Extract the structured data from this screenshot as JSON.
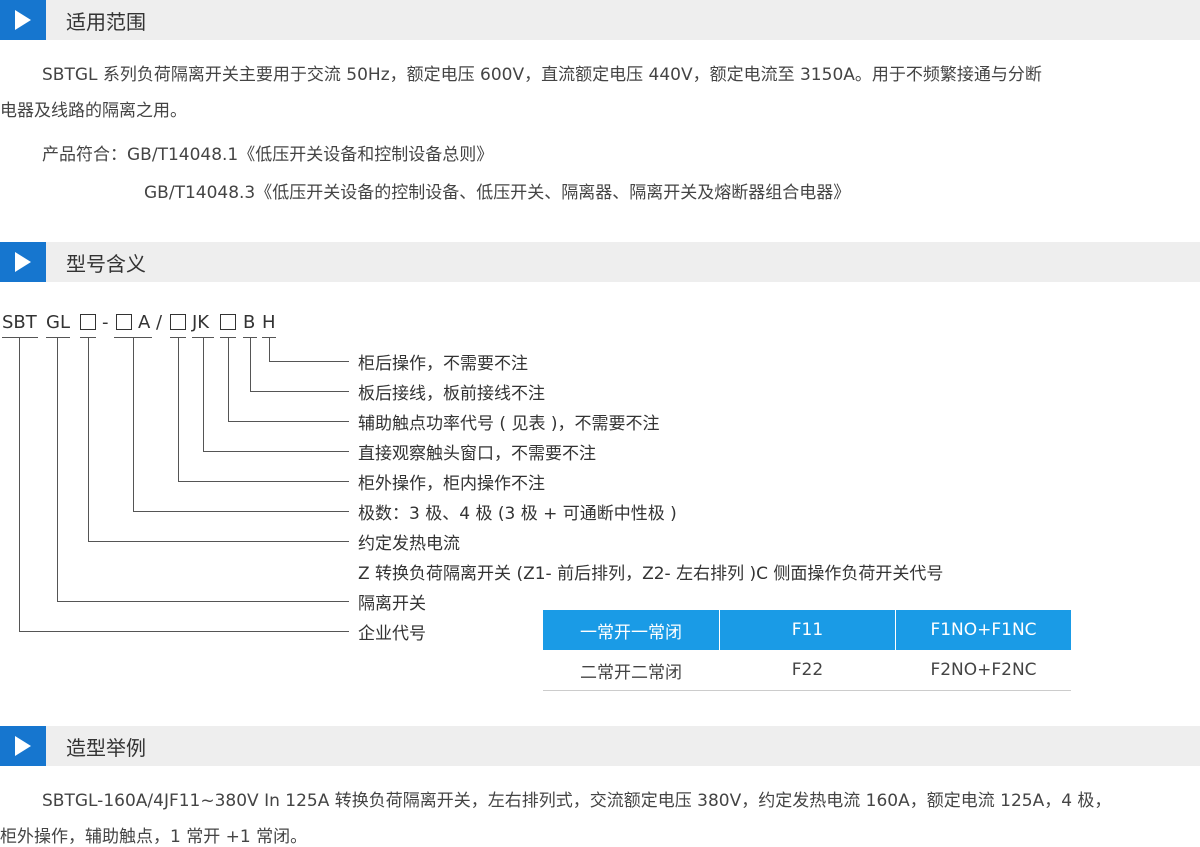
{
  "sections": {
    "scope": {
      "title": "适用范围",
      "line1": "SBTGL 系列负荷隔离开关主要用于交流 50Hz，额定电压 600V，直流额定电压 440V，额定电流至 3150A。用于不频繁接通与分断",
      "line2": "电器及线路的隔离之用。",
      "standard_label": "产品符合：GB/T14048.1《低压开关设备和控制设备总则》",
      "standard_2": "GB/T14048.3《低压开关设备的控制设备、低压开关、隔离器、隔离开关及熔断器组合电器》"
    },
    "model": {
      "title": "型号含义",
      "code_parts": [
        "SBT",
        "GL",
        "-",
        "A",
        "/",
        "JK",
        "B",
        "H"
      ],
      "legend": [
        "柜后操作，不需要不注",
        "板后接线，板前接线不注",
        "辅助触点功率代号 ( 见表 )，不需要不注",
        "直接观察触头窗口，不需要不注",
        "柜外操作，柜内操作不注",
        "极数：3 极、4 极 (3 极 + 可通断中性极 )",
        "约定发热电流",
        "Z 转换负荷隔离开关 (Z1- 前后排列，Z2- 左右排列 )C 侧面操作负荷开关代号",
        "隔离开关",
        "企业代号"
      ],
      "table": {
        "header": [
          "一常开一常闭",
          "F11",
          "F1NO+F1NC"
        ],
        "rows": [
          [
            "二常开二常闭",
            "F22",
            "F2NO+F2NC"
          ]
        ]
      }
    },
    "example": {
      "title": "造型举例",
      "line1": "SBTGL-160A/4JF11~380V In 125A 转换负荷隔离开关，左右排列式，交流额定电压 380V，约定发热电流 160A，额定电流 125A，4 极，",
      "line2": "柜外操作，辅助触点，1 常开 +1 常闭。"
    }
  },
  "colors": {
    "accent": "#1676cf",
    "table_header": "#1a9be6",
    "section_bg": "#eeeeee"
  }
}
